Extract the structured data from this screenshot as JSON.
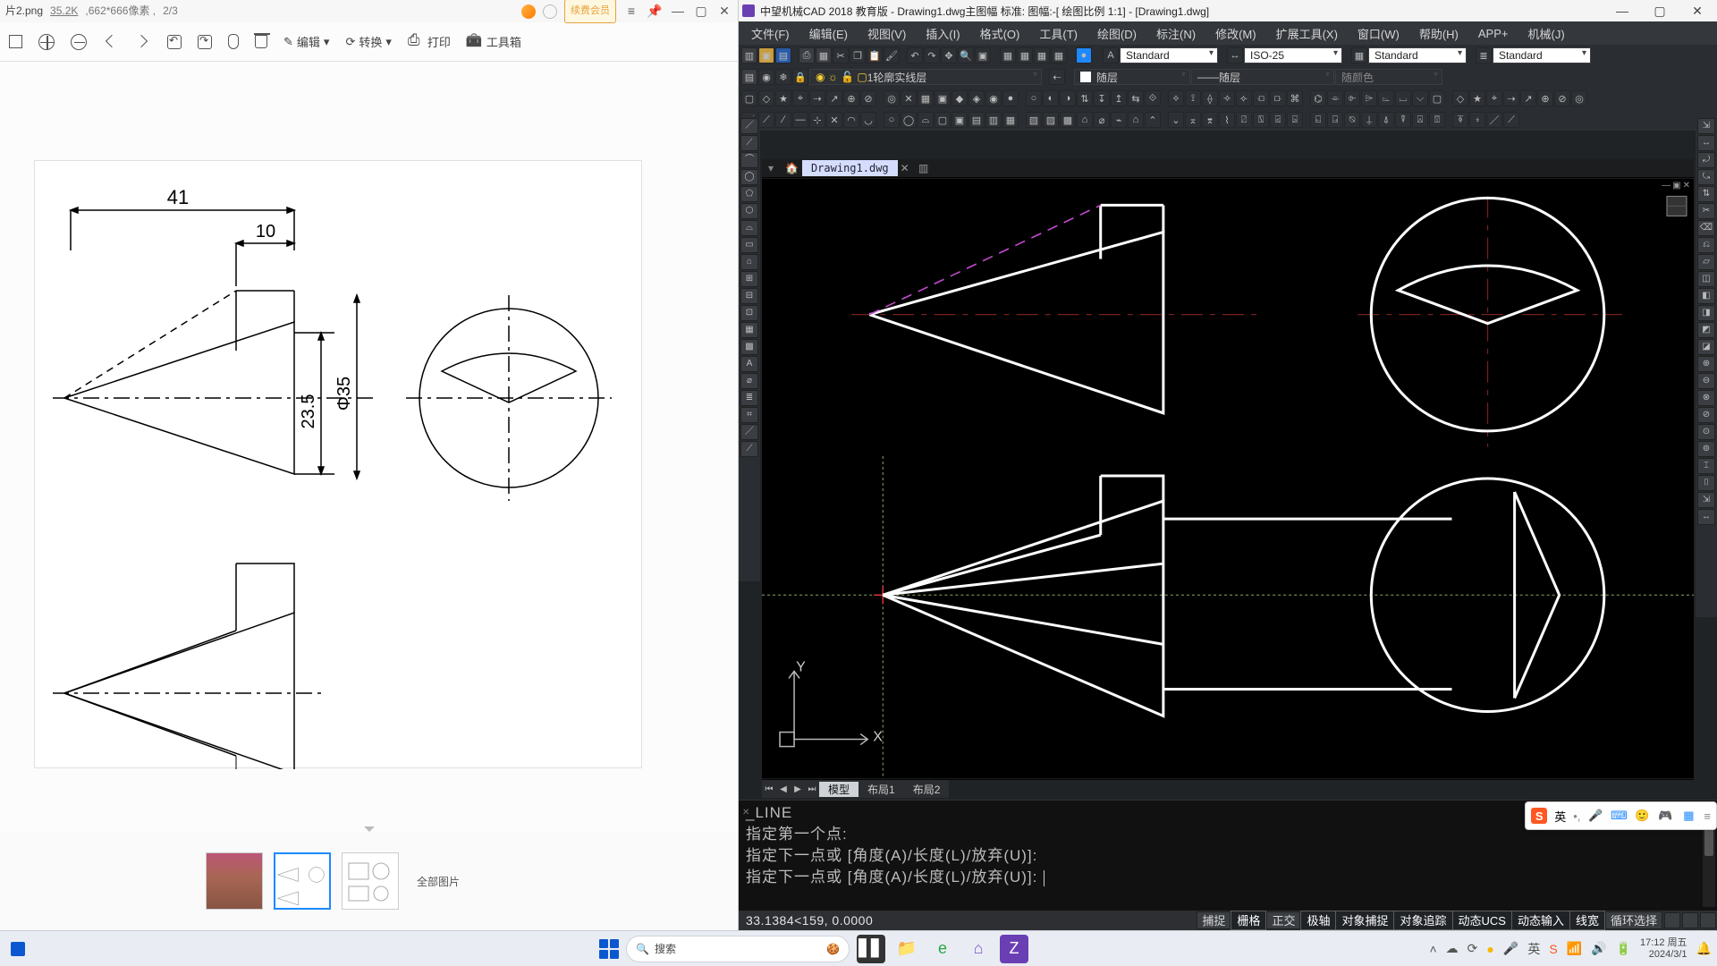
{
  "viewer": {
    "filename": "片2.png",
    "filesize": "35.2K",
    "dimensions": "662*666像素",
    "page_index": "2/3",
    "vip_badge": "续费会员",
    "toolbar": {
      "edit": "编辑",
      "rotate": "转换",
      "print": "打印",
      "toolbox": "工具箱"
    },
    "all_images": "全部图片",
    "drawing": {
      "dim_w": "41",
      "dim_off": "10",
      "dim_h": "23.5",
      "dim_dia": "Φ35"
    }
  },
  "cad": {
    "title": "中望机械CAD 2018 教育版  - Drawing1.dwg主图幅  标准: 图幅:-[ 绘图比例 1:1] - [Drawing1.dwg]",
    "menus": [
      "文件(F)",
      "编辑(E)",
      "视图(V)",
      "插入(I)",
      "格式(O)",
      "工具(T)",
      "绘图(D)",
      "标注(N)",
      "修改(M)",
      "扩展工具(X)",
      "窗口(W)",
      "帮助(H)",
      "APP+",
      "机械(J)"
    ],
    "row1": {
      "style1": "Standard",
      "style2": "ISO-25",
      "style3": "Standard",
      "style4": "Standard"
    },
    "row2": {
      "layer": "1轮廓实线层",
      "bylayer1": "随层",
      "bylayer2": "随层",
      "bycolor": "随颜色"
    },
    "tab": "Drawing1.dwg",
    "layouts": {
      "model": "模型",
      "l1": "布局1",
      "l2": "布局2"
    },
    "cmd": {
      "l0": "_LINE",
      "l1": "指定第一个点:",
      "l2": "指定下一点或 [角度(A)/长度(L)/放弃(U)]:",
      "l3": "指定下一点或 [角度(A)/长度(L)/放弃(U)]: "
    },
    "coords": "33.1384<159, 0.0000",
    "status": [
      "捕捉",
      "栅格",
      "正交",
      "极轴",
      "对象捕捉",
      "对象追踪",
      "动态UCS",
      "动态输入",
      "线宽",
      "循环选择"
    ],
    "ucs": {
      "x": "X",
      "y": "Y"
    }
  },
  "ime": {
    "lang": "英"
  },
  "taskbar": {
    "search_placeholder": "搜索",
    "clock_time": "17:12",
    "clock_day": "周五",
    "clock_date": "2024/3/1"
  }
}
